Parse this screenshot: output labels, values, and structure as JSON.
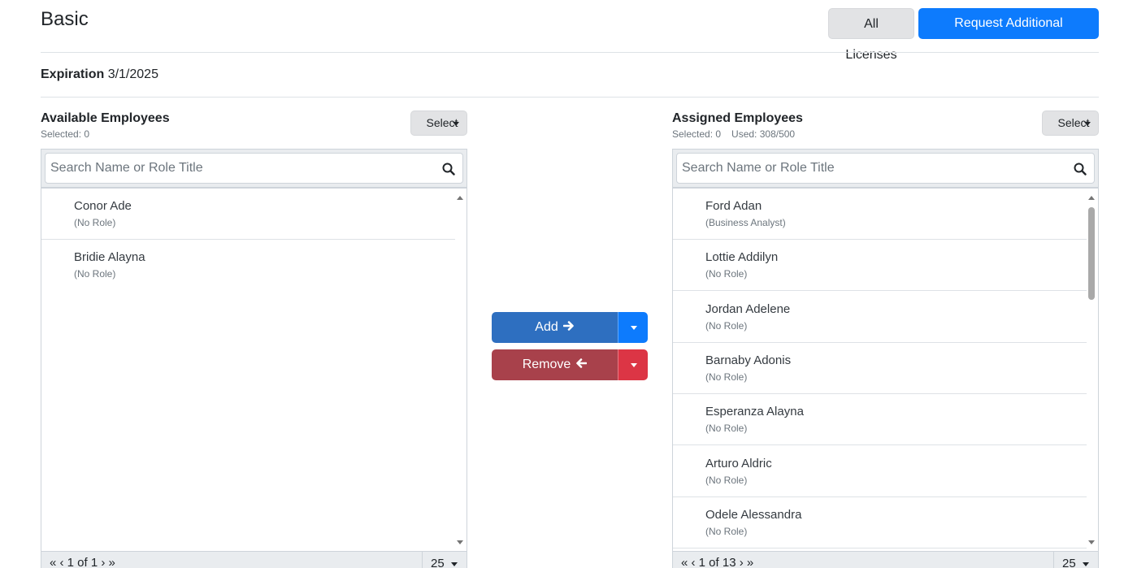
{
  "header": {
    "title": "Basic",
    "all_licenses_label": "All Licenses",
    "request_label": "Request Additional Licenses"
  },
  "expiration": {
    "label": "Expiration",
    "value": "3/1/2025"
  },
  "available": {
    "title": "Available Employees",
    "selected": "Selected: 0",
    "select_label": "Select",
    "search_placeholder": "Search Name or Role Title",
    "items": [
      {
        "name": "Conor Ade",
        "role": "(No Role)"
      },
      {
        "name": "Bridie Alayna",
        "role": "(No Role)"
      }
    ],
    "pager": "« ‹ 1 of 1 › »",
    "page_size": "25"
  },
  "assigned": {
    "title": "Assigned Employees",
    "selected": "Selected: 0",
    "used": "Used: 308/500",
    "select_label": "Select",
    "search_placeholder": "Search Name or Role Title",
    "items": [
      {
        "name": "Ford Adan",
        "role": "(Business Analyst)"
      },
      {
        "name": "Lottie Addilyn",
        "role": "(No Role)"
      },
      {
        "name": "Jordan Adelene",
        "role": "(No Role)"
      },
      {
        "name": "Barnaby Adonis",
        "role": "(No Role)"
      },
      {
        "name": "Esperanza Alayna",
        "role": "(No Role)"
      },
      {
        "name": "Arturo Aldric",
        "role": "(No Role)"
      },
      {
        "name": "Odele Alessandra",
        "role": "(No Role)"
      }
    ],
    "pager": "« ‹ 1 of 13 › »",
    "page_size": "25"
  },
  "actions": {
    "add_label": "Add",
    "remove_label": "Remove"
  },
  "colors": {
    "primary": "#0d7bfd",
    "add": "#2e6fc0",
    "remove": "#a8414b",
    "danger": "#dc3545"
  }
}
